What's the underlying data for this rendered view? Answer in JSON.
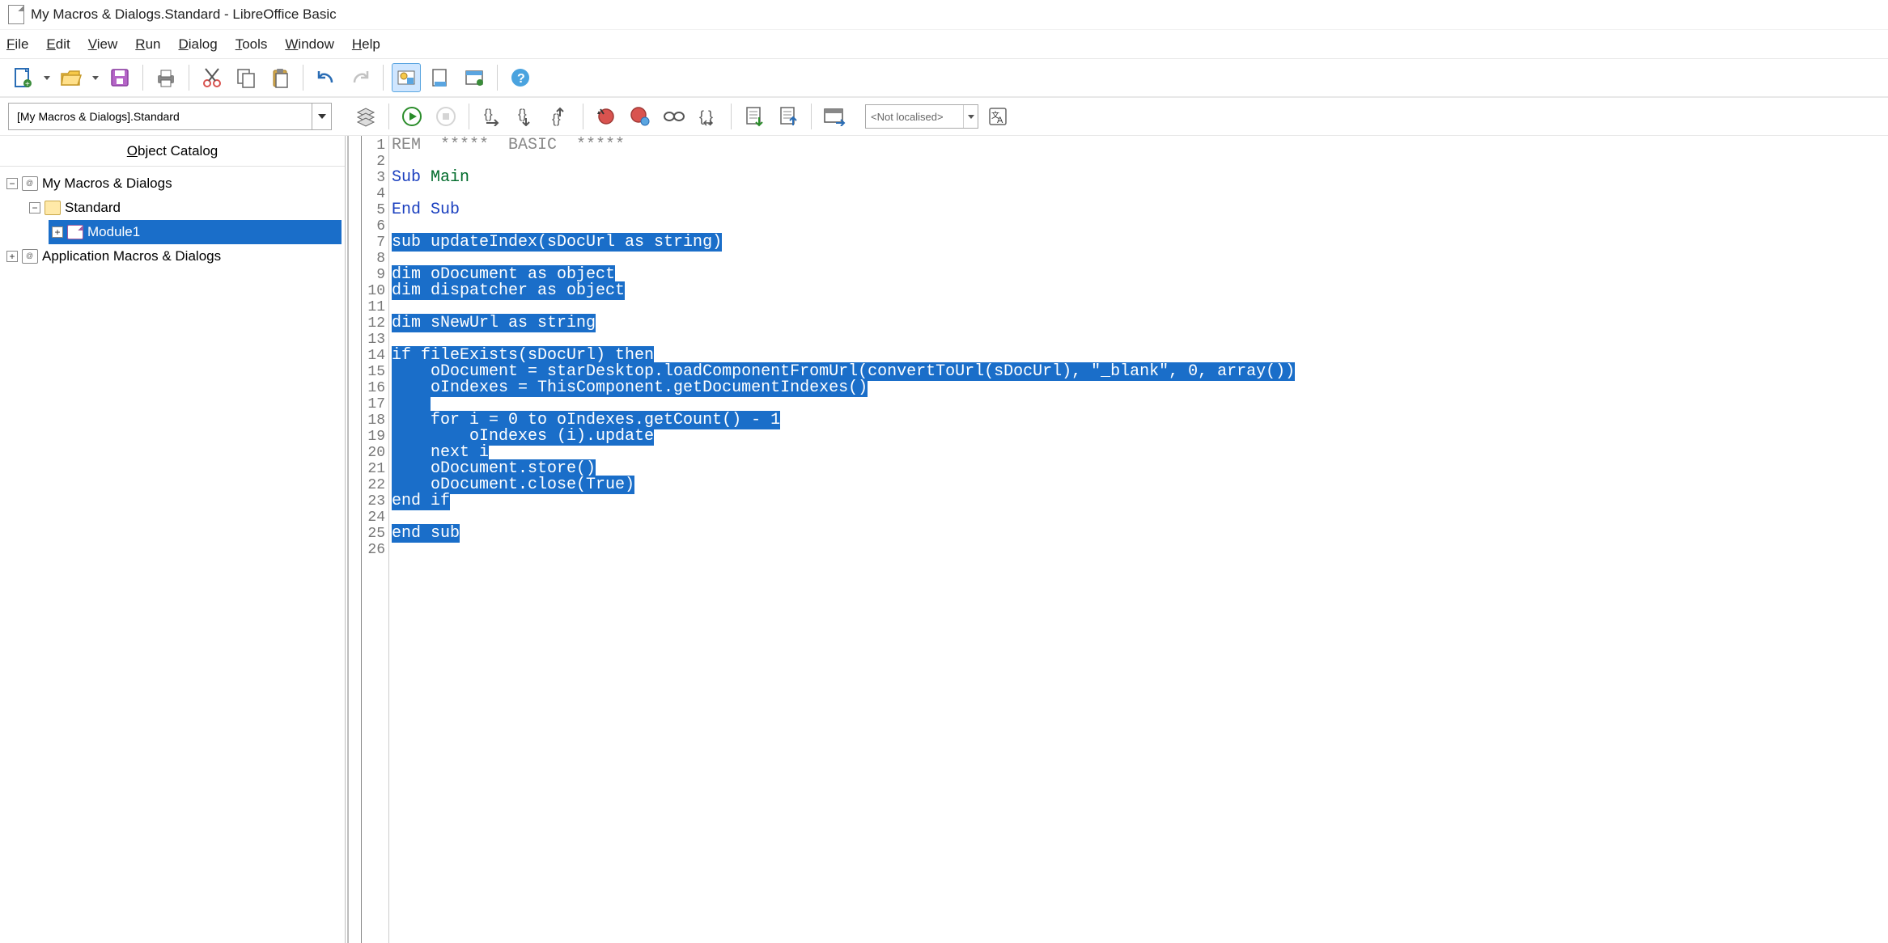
{
  "window": {
    "title": "My Macros & Dialogs.Standard - LibreOffice Basic"
  },
  "menu": {
    "file": "File",
    "edit": "Edit",
    "view": "View",
    "run": "Run",
    "dialog": "Dialog",
    "tools": "Tools",
    "window": "Window",
    "help": "Help"
  },
  "toolbar2": {
    "library": "[My Macros & Dialogs].Standard",
    "locale": "<Not localised>"
  },
  "sidebar": {
    "title": "Object Catalog",
    "items": {
      "root1": "My Macros & Dialogs",
      "standard": "Standard",
      "module1": "Module1",
      "root2": "Application Macros & Dialogs"
    }
  },
  "code": {
    "lines": [
      {
        "n": 1,
        "tokens": [
          {
            "t": "comment",
            "s": "REM  *****  BASIC  *****"
          }
        ]
      },
      {
        "n": 2,
        "tokens": []
      },
      {
        "n": 3,
        "tokens": [
          {
            "t": "kw",
            "s": "Sub "
          },
          {
            "t": "ident",
            "s": "Main"
          }
        ]
      },
      {
        "n": 4,
        "tokens": []
      },
      {
        "n": 5,
        "tokens": [
          {
            "t": "kw",
            "s": "End Sub"
          }
        ]
      },
      {
        "n": 6,
        "tokens": []
      },
      {
        "n": 7,
        "sel": true,
        "tokens": [
          {
            "t": "",
            "s": "sub updateIndex(sDocUrl as string)"
          }
        ]
      },
      {
        "n": 8,
        "tokens": []
      },
      {
        "n": 9,
        "sel": true,
        "tokens": [
          {
            "t": "",
            "s": "dim oDocument as object"
          }
        ]
      },
      {
        "n": 10,
        "sel": true,
        "tokens": [
          {
            "t": "",
            "s": "dim dispatcher as object"
          }
        ]
      },
      {
        "n": 11,
        "tokens": []
      },
      {
        "n": 12,
        "sel": true,
        "tokens": [
          {
            "t": "",
            "s": "dim sNewUrl as string"
          }
        ]
      },
      {
        "n": 13,
        "tokens": []
      },
      {
        "n": 14,
        "sel": true,
        "tokens": [
          {
            "t": "",
            "s": "if fileExists(sDocUrl) then"
          }
        ]
      },
      {
        "n": 15,
        "sel": true,
        "tokens": [
          {
            "t": "",
            "s": "    oDocument = starDesktop.loadComponentFromUrl(convertToUrl(sDocUrl), \"_blank\", 0, array())"
          }
        ]
      },
      {
        "n": 16,
        "sel": true,
        "tokens": [
          {
            "t": "",
            "s": "    oIndexes = ThisComponent.getDocumentIndexes()"
          }
        ]
      },
      {
        "n": 17,
        "sel": true,
        "tokens": [
          {
            "t": "",
            "s": "    "
          }
        ]
      },
      {
        "n": 18,
        "sel": true,
        "tokens": [
          {
            "t": "",
            "s": "    for i = 0 to oIndexes.getCount() - 1"
          }
        ]
      },
      {
        "n": 19,
        "sel": true,
        "tokens": [
          {
            "t": "",
            "s": "        oIndexes (i).update"
          }
        ]
      },
      {
        "n": 20,
        "sel": true,
        "tokens": [
          {
            "t": "",
            "s": "    next i"
          }
        ]
      },
      {
        "n": 21,
        "sel": true,
        "tokens": [
          {
            "t": "",
            "s": "    oDocument.store()"
          }
        ]
      },
      {
        "n": 22,
        "sel": true,
        "tokens": [
          {
            "t": "",
            "s": "    oDocument.close(True)"
          }
        ]
      },
      {
        "n": 23,
        "sel": true,
        "tokens": [
          {
            "t": "",
            "s": "end if"
          }
        ]
      },
      {
        "n": 24,
        "tokens": []
      },
      {
        "n": 25,
        "sel": true,
        "tokens": [
          {
            "t": "",
            "s": "end sub"
          }
        ]
      },
      {
        "n": 26,
        "tokens": []
      }
    ]
  }
}
